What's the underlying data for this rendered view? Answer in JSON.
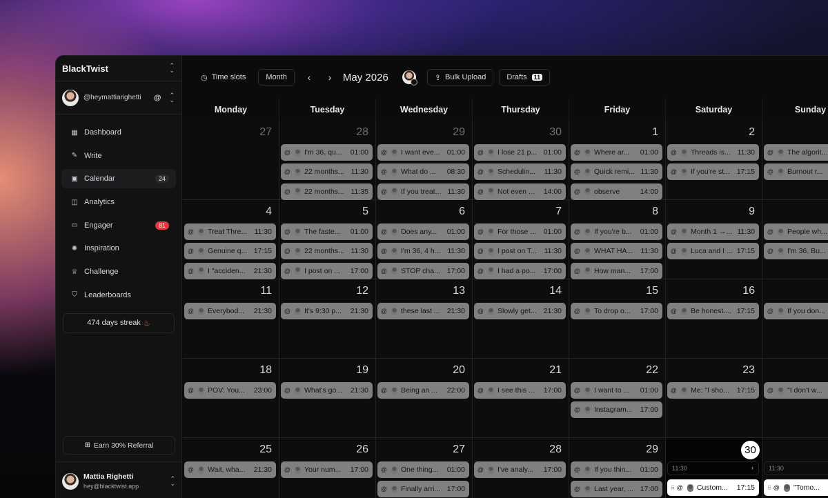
{
  "sidebar": {
    "brand": "BlackTwist",
    "handle": "@heymattiarighetti",
    "nav": [
      {
        "icon": "dashboard-icon",
        "glyph": "▦",
        "label": "Dashboard",
        "count": ""
      },
      {
        "icon": "pencil-icon",
        "glyph": "✎",
        "label": "Write",
        "count": ""
      },
      {
        "icon": "calendar-icon",
        "glyph": "▣",
        "label": "Calendar",
        "count": "24",
        "active": true
      },
      {
        "icon": "analytics-icon",
        "glyph": "◫",
        "label": "Analytics",
        "count": ""
      },
      {
        "icon": "chat-icon",
        "glyph": "▭",
        "label": "Engager",
        "count": "81",
        "red": true
      },
      {
        "icon": "lightbulb-icon",
        "glyph": "✺",
        "label": "Inspiration",
        "count": ""
      },
      {
        "icon": "trophy-icon",
        "glyph": "♕",
        "label": "Challenge",
        "count": ""
      },
      {
        "icon": "leaderboard-icon",
        "glyph": "⛉",
        "label": "Leaderboards",
        "count": ""
      }
    ],
    "streak": "474 days streak",
    "referral": "Earn 30% Referral",
    "user_name": "Mattia Righetti",
    "user_email": "hey@blacktwist.app"
  },
  "toolbar": {
    "time_slots": "Time slots",
    "view": "Month",
    "month_title": "May 2026",
    "bulk_upload": "Bulk Upload",
    "drafts": "Drafts",
    "drafts_count": "11"
  },
  "weekdays": [
    "Monday",
    "Tuesday",
    "Wednesday",
    "Thursday",
    "Friday",
    "Saturday",
    "Sunday"
  ],
  "weeks": [
    [
      {
        "day": "27",
        "dim": true,
        "posts": []
      },
      {
        "day": "28",
        "dim": true,
        "posts": [
          [
            "I'm 36, qu...",
            "01:00"
          ],
          [
            "22 months...",
            "11:30"
          ],
          [
            "22 months...",
            "11:35"
          ]
        ]
      },
      {
        "day": "29",
        "dim": true,
        "posts": [
          [
            "I want eve...",
            "01:00"
          ],
          [
            "What do ...",
            "08:30"
          ],
          [
            "If you treat...",
            "11:30"
          ]
        ]
      },
      {
        "day": "30",
        "dim": true,
        "posts": [
          [
            "I lose 21 p...",
            "01:00"
          ],
          [
            "Schedulin...",
            "11:30"
          ],
          [
            "Not even ...",
            "14:00"
          ]
        ]
      },
      {
        "day": "1",
        "posts": [
          [
            "Where ar...",
            "01:00"
          ],
          [
            "Quick remi...",
            "11:30"
          ],
          [
            "observe",
            "14:00"
          ]
        ]
      },
      {
        "day": "2",
        "posts": [
          [
            "Threads is...",
            "11:30"
          ],
          [
            "If you're st...",
            "17:15"
          ]
        ]
      },
      {
        "day": "",
        "posts": [
          [
            "The algorit...",
            ""
          ],
          [
            "Burnout r...",
            ""
          ]
        ]
      }
    ],
    [
      {
        "day": "4",
        "posts": [
          [
            "Treat Thre...",
            "11:30"
          ],
          [
            "Genuine q...",
            "17:15"
          ],
          [
            "I \"acciden...",
            "21:30"
          ]
        ]
      },
      {
        "day": "5",
        "posts": [
          [
            "The faste...",
            "01:00"
          ],
          [
            "22 months...",
            "11:30"
          ],
          [
            "I post on ...",
            "17:00"
          ]
        ]
      },
      {
        "day": "6",
        "posts": [
          [
            "Does any...",
            "01:00"
          ],
          [
            "I'm 36, 4 h...",
            "11:30"
          ],
          [
            "STOP cha...",
            "17:00"
          ]
        ]
      },
      {
        "day": "7",
        "posts": [
          [
            "For those ...",
            "01:00"
          ],
          [
            "I post on T...",
            "11:30"
          ],
          [
            "I had a po...",
            "17:00"
          ]
        ]
      },
      {
        "day": "8",
        "posts": [
          [
            "If you're b...",
            "01:00"
          ],
          [
            "WHAT HA...",
            "11:30"
          ],
          [
            "How man...",
            "17:00"
          ]
        ]
      },
      {
        "day": "9",
        "posts": [
          [
            "Month 1 →...",
            "11:30"
          ],
          [
            "Luca and I ...",
            "17:15"
          ]
        ]
      },
      {
        "day": "",
        "posts": [
          [
            "People wh...",
            ""
          ],
          [
            "I'm 36. Bu...",
            ""
          ]
        ]
      }
    ],
    [
      {
        "day": "11",
        "posts": [
          [
            "Everybod...",
            "21:30"
          ]
        ]
      },
      {
        "day": "12",
        "posts": [
          [
            "It's 9:30 p...",
            "21:30"
          ]
        ]
      },
      {
        "day": "13",
        "posts": [
          [
            "these last ...",
            "21:30"
          ]
        ]
      },
      {
        "day": "14",
        "posts": [
          [
            "Slowly get...",
            "21:30"
          ]
        ]
      },
      {
        "day": "15",
        "posts": [
          [
            "To drop o...",
            "17:00"
          ]
        ]
      },
      {
        "day": "16",
        "posts": [
          [
            "Be honest....",
            "17:15"
          ]
        ]
      },
      {
        "day": "",
        "posts": [
          [
            "If you don...",
            ""
          ]
        ]
      }
    ],
    [
      {
        "day": "18",
        "posts": [
          [
            "POV: You...",
            "23:00"
          ]
        ]
      },
      {
        "day": "19",
        "posts": [
          [
            "What's go...",
            "21:30"
          ]
        ]
      },
      {
        "day": "20",
        "posts": [
          [
            "Being an ...",
            "22:00"
          ]
        ]
      },
      {
        "day": "21",
        "posts": [
          [
            "I see this ...",
            "17:00"
          ]
        ]
      },
      {
        "day": "22",
        "posts": [
          [
            "I want to ...",
            "01:00"
          ],
          [
            "Instagram...",
            "17:00"
          ]
        ]
      },
      {
        "day": "23",
        "posts": [
          [
            "Me: \"I sho...",
            "17:15"
          ]
        ]
      },
      {
        "day": "",
        "posts": [
          [
            "\"I don't w...",
            ""
          ]
        ]
      }
    ],
    [
      {
        "day": "25",
        "posts": [
          [
            "Wait, wha...",
            "21:30"
          ]
        ]
      },
      {
        "day": "26",
        "posts": [
          [
            "Your num...",
            "17:00"
          ]
        ]
      },
      {
        "day": "27",
        "posts": [
          [
            "One thing...",
            "01:00"
          ],
          [
            "Finally arri...",
            "17:00"
          ]
        ]
      },
      {
        "day": "28",
        "posts": [
          [
            "I've analy...",
            "17:00"
          ]
        ]
      },
      {
        "day": "29",
        "posts": [
          [
            "If you thin...",
            "01:00"
          ],
          [
            "Last year, ...",
            "17:00"
          ]
        ]
      },
      {
        "day": "30",
        "today": true,
        "slot": "11:30",
        "slot_add": "+",
        "white_posts": [
          [
            "Custom...",
            "17:15"
          ]
        ]
      },
      {
        "day": "",
        "slot": "11:30",
        "white_posts": [
          [
            "\"Tomo...",
            ""
          ]
        ]
      }
    ]
  ]
}
